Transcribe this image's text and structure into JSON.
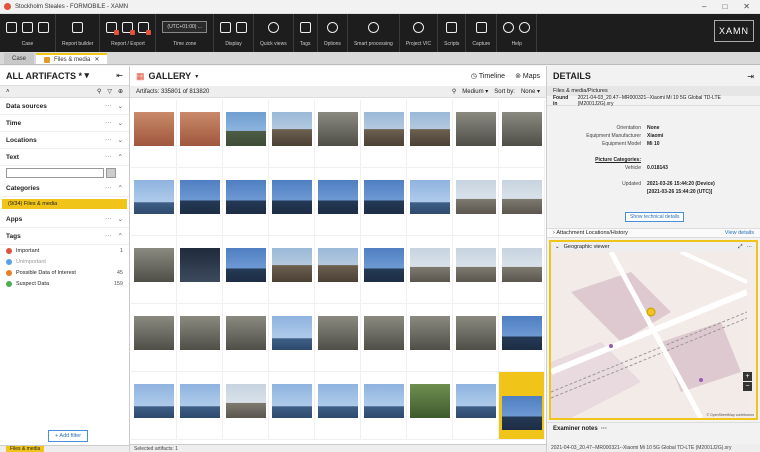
{
  "window": {
    "title": "Stockholm Steales - FORMOBILE - XAMN"
  },
  "ribbon": {
    "groups": [
      {
        "label": "Case"
      },
      {
        "label": "Report builder"
      },
      {
        "label": "Report / Export"
      },
      {
        "label": "Time zone",
        "value": "(UTC+01:00) ..."
      },
      {
        "label": "Display"
      },
      {
        "label": "Quick views"
      },
      {
        "label": "Tags"
      },
      {
        "label": "Options"
      },
      {
        "label": "Smart processing"
      },
      {
        "label": "Project VIC"
      },
      {
        "label": "Scripts"
      },
      {
        "label": "Capture"
      },
      {
        "label": "Help"
      }
    ],
    "logo": "XAMN"
  },
  "tabs": [
    {
      "label": "Case"
    },
    {
      "label": "Files & media"
    }
  ],
  "left": {
    "title": "ALL ARTIFACTS",
    "title_suffix": "*",
    "sections": {
      "data_sources": "Data sources",
      "time": "Time",
      "locations": "Locations",
      "text": "Text",
      "categories": "Categories",
      "apps": "Apps",
      "tags": "Tags"
    },
    "category_selected": "(9/34) Files & media",
    "tags": [
      {
        "label": "Important",
        "count": "1",
        "color": "#e0533d"
      },
      {
        "label": "Unimportant",
        "count": "",
        "color": "#5aa0e6"
      },
      {
        "label": "Possible Data of Interest",
        "count": "45",
        "color": "#e67e22"
      },
      {
        "label": "Suspect Data",
        "count": "159",
        "color": "#4caf50"
      }
    ],
    "add_filter": "+ Add filter",
    "bottom_tag": "Files & media"
  },
  "gallery": {
    "title": "GALLERY",
    "timeline": "Timeline",
    "maps": "Maps",
    "count": "Artifacts: 335801 of 813820",
    "size": "Medium",
    "sort_label": "Sort by:",
    "sort_value": "None",
    "selected_status": "Selected artifacts: 1",
    "thumbnail_tones": [
      "t0",
      "t0",
      "t2",
      "t3",
      "t1",
      "t3",
      "t3",
      "t1",
      "t1",
      "t8",
      "t4",
      "t4",
      "t4",
      "t4",
      "t4",
      "t8",
      "t5",
      "t5",
      "t1",
      "t6",
      "t4",
      "t3",
      "t3",
      "t4",
      "t5",
      "t5",
      "t5",
      "t1",
      "t1",
      "t1",
      "t8",
      "t1",
      "t1",
      "t1",
      "t1",
      "t4",
      "t8",
      "t8",
      "t5",
      "t8",
      "t8",
      "t8",
      "t7",
      "t8",
      "t4"
    ],
    "selected_index": 44
  },
  "details": {
    "title": "DETAILS",
    "sub": "Files & media/Pictures",
    "found_label": "Found in",
    "found_value": "2021-04-03_20.47--MR000321--Xiaomi Mi 10 5G Global TD-LTE (M2001J2G).xry",
    "props": [
      {
        "k": "Orientation",
        "v": "None"
      },
      {
        "k": "Equipment Manufacturer",
        "v": "Xiaomi"
      },
      {
        "k": "Equipment Model",
        "v": "Mi 10"
      }
    ],
    "pic_cat": "Picture Categories:",
    "vehicle_k": "Vehicle",
    "vehicle_v": "0.018143",
    "updated_k": "Updated",
    "updated_v1": "2021-03-26 15:44:20 (Device)",
    "updated_v2": "[2021-03-26 15:44:20 (UTC)]",
    "show_tech": "Show technical details",
    "attachment": "Attachment Locations/History",
    "view_details": "View details",
    "geo": "Geographic viewer",
    "osm": "© OpenStreetMap contributors",
    "examiner": "Examiner notes",
    "bottom": "2021-04-03_20.47--MR000321--Xiaomi Mi 10 5G Global TD-LTE (M2001J2G).xry"
  }
}
